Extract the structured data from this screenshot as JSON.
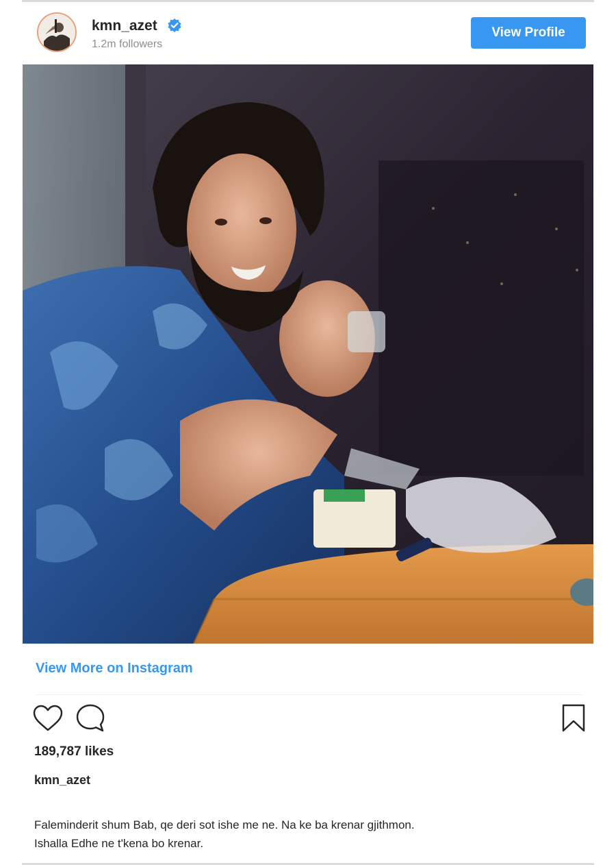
{
  "header": {
    "username": "kmn_azet",
    "followers": "1.2m followers",
    "view_profile_label": "View Profile"
  },
  "post": {
    "view_more_label": "View More on Instagram",
    "likes": "189,787 likes",
    "caption_user": "kmn_azet",
    "caption_line1": "Faleminderit shum Bab, qe deri sot ishe me ne. Na ke ba krenar gjithmon.",
    "caption_line2": "Ishalla Edhe ne t'kena bo krenar."
  },
  "icons": {
    "verified": "verified-badge-icon",
    "like": "heart-icon",
    "comment": "comment-icon",
    "save": "bookmark-icon"
  },
  "colors": {
    "accent": "#3897f0",
    "text": "#262626",
    "muted": "#8e8e8e"
  }
}
